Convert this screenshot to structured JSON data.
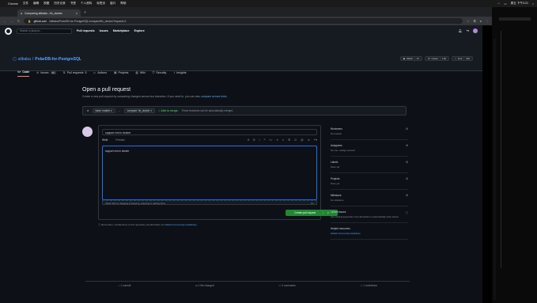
{
  "menubar": {
    "app": "Chrome",
    "items": [
      "文件",
      "编辑",
      "视图",
      "历史记录",
      "书签",
      "个人资料",
      "标签页",
      "窗口",
      "帮助"
    ],
    "clock": "周五 下午3:21"
  },
  "browser": {
    "tab_title": "Comparing alibaba...:fix_docker",
    "url_host": "github.com",
    "url_path": "/alibaba/PolarDB-for-PostgreSQL/compare/fix_docker?expand=1"
  },
  "gh": {
    "search_placeholder": "Search or jump to...",
    "nav": [
      "Pull requests",
      "Issues",
      "Marketplace",
      "Explore"
    ]
  },
  "repo": {
    "owner": "alibaba",
    "name": "PolarDB-for-PostgreSQL",
    "actions": [
      {
        "label": "Watch",
        "count": "47"
      },
      {
        "label": "Unstar",
        "count": "1.6k"
      },
      {
        "label": "Fork",
        "count": "291"
      }
    ],
    "tabs": [
      {
        "label": "Code",
        "count": ""
      },
      {
        "label": "Issues",
        "count": "59"
      },
      {
        "label": "Pull requests",
        "count": "5"
      },
      {
        "label": "Actions",
        "count": ""
      },
      {
        "label": "Projects",
        "count": ""
      },
      {
        "label": "Wiki",
        "count": ""
      },
      {
        "label": "Security",
        "count": ""
      },
      {
        "label": "Insights",
        "count": ""
      }
    ]
  },
  "pr": {
    "heading": "Open a pull request",
    "subtitle": "Create a new pull request by comparing changes across two branches. If you need to, you can also",
    "subtitle_link": "compare across forks.",
    "base": "base: master ▾",
    "compare": "compare: fix_docker ▾",
    "able": "✓ Able to merge.",
    "able_note": "These branches can be automatically merged.",
    "title_value": "support vim in docker",
    "tab_write": "Write",
    "tab_preview": "Preview",
    "body_value": "support vim in docker",
    "attach_hint": "Attach files by dragging & dropping, selecting or pasting them.",
    "create_label": "Create pull request",
    "note": "Remember, contributions to this repository should follow our",
    "note_link": "GitHub Community Guidelines."
  },
  "sidebar": [
    {
      "title": "Reviewers",
      "value": "No reviews"
    },
    {
      "title": "Assignees",
      "value": "No one—assign yourself"
    },
    {
      "title": "Labels",
      "value": "None yet"
    },
    {
      "title": "Projects",
      "value": "None yet"
    },
    {
      "title": "Milestone",
      "value": "No milestone"
    },
    {
      "title": "Linked issues",
      "value": "Use Closing keywords in the description to automatically close issues"
    },
    {
      "title": "Helpful resources",
      "value": "GitHub Community Guidelines"
    }
  ],
  "stats": [
    "1 commit",
    "1 file changed",
    "0 comments",
    "1 contributor"
  ]
}
